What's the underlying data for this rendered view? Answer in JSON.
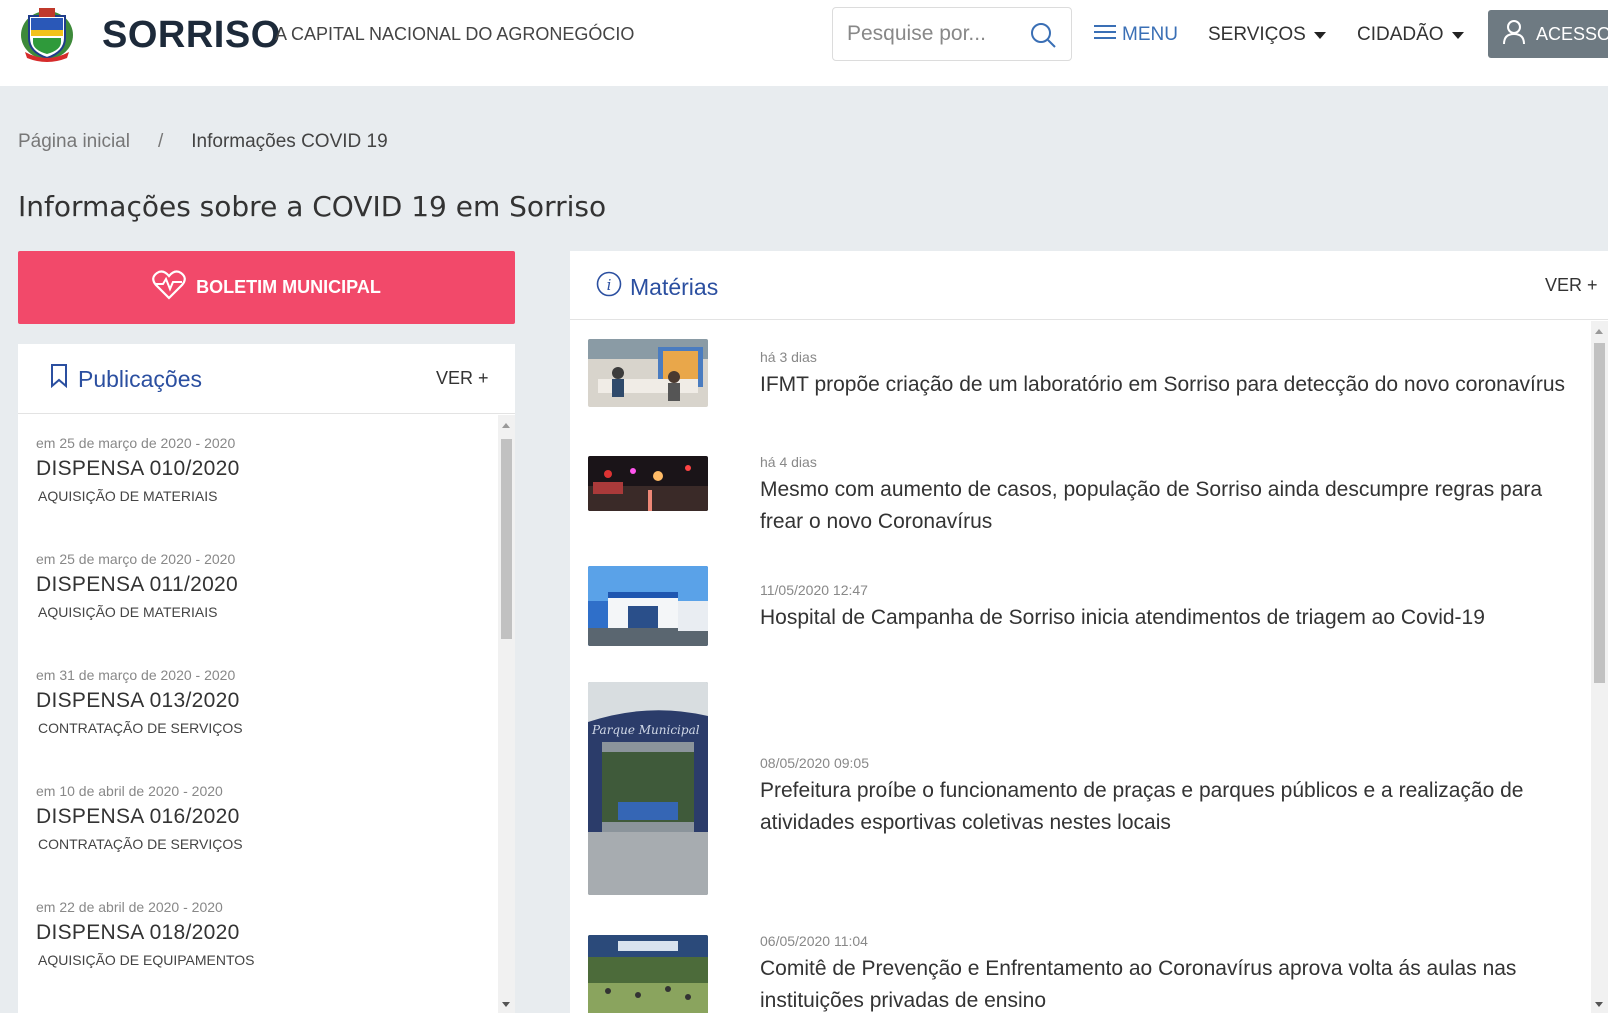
{
  "header": {
    "brand": "SORRISO",
    "tagline": "A CAPITAL NACIONAL DO AGRONEGÓCIO",
    "search_placeholder": "Pesquise por...",
    "menu_label": "MENU",
    "nav": [
      {
        "label": "SERVIÇOS"
      },
      {
        "label": "CIDADÃO"
      }
    ],
    "acesso_label": "ACESSO"
  },
  "breadcrumb": {
    "home": "Página inicial",
    "separator": "/",
    "current": "Informações COVID 19"
  },
  "page_title": "Informações sobre a COVID 19 em Sorriso",
  "boletim_label": "BOLETIM MUNICIPAL",
  "publicacoes": {
    "title": "Publicações",
    "ver_label": "VER +",
    "items": [
      {
        "date": "em 25 de março de 2020 - 2020",
        "name": "DISPENSA 010/2020",
        "subject": "AQUISIÇÃO DE MATERIAIS"
      },
      {
        "date": "em 25 de março de 2020 - 2020",
        "name": "DISPENSA 011/2020",
        "subject": "AQUISIÇÃO DE MATERIAIS"
      },
      {
        "date": "em 31 de março de 2020 - 2020",
        "name": "DISPENSA 013/2020",
        "subject": "CONTRATAÇÃO DE SERVIÇOS"
      },
      {
        "date": "em 10 de abril de 2020 - 2020",
        "name": "DISPENSA 016/2020",
        "subject": "CONTRATAÇÃO DE SERVIÇOS"
      },
      {
        "date": "em 22 de abril de 2020 - 2020",
        "name": "DISPENSA 018/2020",
        "subject": "AQUISIÇÃO DE EQUIPAMENTOS"
      }
    ]
  },
  "materias": {
    "title": "Matérias",
    "ver_label": "VER +",
    "items": [
      {
        "date": "há 3 dias",
        "headline": "IFMT propõe criação de um laboratório em Sorriso para detecção do novo coronavírus"
      },
      {
        "date": "há 4 dias",
        "headline": "Mesmo com aumento de casos, população de Sorriso ainda descumpre regras para frear o novo Coronavírus"
      },
      {
        "date": "11/05/2020 12:47",
        "headline": "Hospital de Campanha de Sorriso inicia atendimentos de triagem ao Covid-19"
      },
      {
        "date": "08/05/2020 09:05",
        "headline": "Prefeitura proíbe o funcionamento de praças e parques públicos e a realização de atividades esportivas coletivas nestes locais",
        "sign_text": "Parque Municipal"
      },
      {
        "date": "06/05/2020 11:04",
        "headline": "Comitê de Prevenção e Enfrentamento ao Coronavírus aprova volta ás aulas nas instituições privadas de ensino"
      }
    ]
  },
  "colors": {
    "accent_blue": "#2b4fa0",
    "boletim_red": "#f2496a",
    "acesso_gray": "#6e7a82"
  }
}
